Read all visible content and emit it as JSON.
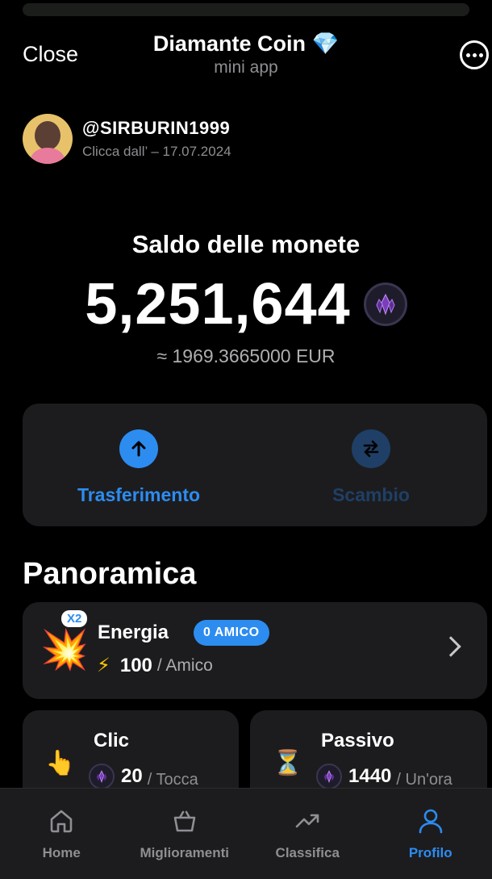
{
  "header": {
    "close_label": "Close",
    "title": "Diamante Coin 💎",
    "subtitle": "mini app",
    "more_icon": "more-horizontal-icon"
  },
  "profile": {
    "username": "@SIRBURIN1999",
    "joined": "Clicca dall’ – 17.07.2024"
  },
  "balance": {
    "label": "Saldo delle monete",
    "value": "5,251,644",
    "eur": "≈ 1969.3665000 EUR",
    "coin_icon": "crystal-coin-icon"
  },
  "actions": [
    {
      "label": "Trasferimento",
      "icon": "arrow-up-icon",
      "color": "#2d8cf0"
    },
    {
      "label": "Scambio",
      "icon": "swap-arrows-icon",
      "color": "#1f3f66"
    }
  ],
  "overview": {
    "title": "Panoramica",
    "energy": {
      "badge": "X2",
      "title": "Energia",
      "friend_badge": "0 AMICO",
      "value": "100",
      "unit": "/ Amico",
      "icons": [
        "burst-icon",
        "bolt-icon",
        "chevron-right-icon"
      ]
    },
    "click": {
      "title": "Clic",
      "value": "20",
      "unit": "/ Tocca",
      "icon": "pointing-hand-icon"
    },
    "passive": {
      "title": "Passivo",
      "value": "1440",
      "unit": "/ Un'ora",
      "icon": "hourglass-icon"
    }
  },
  "tabbar": [
    {
      "label": "Home",
      "icon": "home-icon",
      "active": false
    },
    {
      "label": "Miglioramenti",
      "icon": "shopping-bag-icon",
      "active": false
    },
    {
      "label": "Classifica",
      "icon": "trending-up-icon",
      "active": false
    },
    {
      "label": "Profilo",
      "icon": "user-icon",
      "active": true
    }
  ],
  "colors": {
    "accent": "#2d8cf0",
    "card": "#1c1c1e",
    "background": "#000000"
  }
}
